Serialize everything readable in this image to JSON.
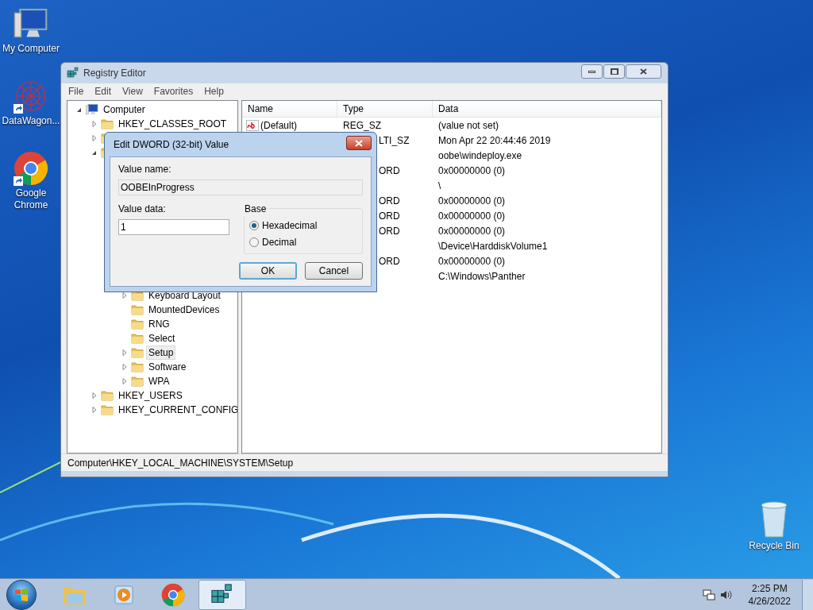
{
  "desktop_icons": [
    {
      "kind": "computer",
      "label": "My Computer",
      "shortcut": false
    },
    {
      "kind": "datawagon",
      "label": "DataWagon...",
      "shortcut": true
    },
    {
      "kind": "chrome",
      "label": "Google Chrome",
      "shortcut": true
    },
    {
      "kind": "recycle",
      "label": "Recycle Bin",
      "shortcut": false
    }
  ],
  "window": {
    "title": "Registry Editor",
    "menu": [
      "File",
      "Edit",
      "View",
      "Favorites",
      "Help"
    ],
    "tree": [
      {
        "kind": "computer",
        "label": "Computer",
        "expandable": true,
        "expanded": true,
        "selected": false,
        "children": [
          {
            "kind": "folder",
            "label": "HKEY_CLASSES_ROOT",
            "expandable": true,
            "expanded": false,
            "selected": false
          },
          {
            "kind": "folder",
            "expandable": true,
            "expanded": false
          },
          {
            "kind": "folder",
            "expandable": true,
            "expanded": true,
            "children": [
              {
                "expanded": true,
                "children": [
                  {
                    "kind": "folder",
                    "label": "Keyboard Layout",
                    "expandable": true,
                    "expanded": false,
                    "selected": false
                  },
                  {
                    "kind": "folder",
                    "label": "MountedDevices",
                    "expandable": false,
                    "selected": false
                  },
                  {
                    "kind": "folder",
                    "label": "RNG",
                    "expandable": false,
                    "selected": false
                  },
                  {
                    "kind": "folder",
                    "label": "Select",
                    "expandable": false,
                    "selected": false
                  },
                  {
                    "kind": "folder",
                    "label": "Setup",
                    "expandable": true,
                    "expanded": false,
                    "selected": true
                  },
                  {
                    "kind": "folder",
                    "label": "Software",
                    "expandable": true,
                    "expanded": false,
                    "selected": false
                  },
                  {
                    "kind": "folder",
                    "label": "WPA",
                    "expandable": true,
                    "expanded": false,
                    "selected": false
                  }
                ]
              }
            ]
          },
          {
            "kind": "folder",
            "label": "HKEY_USERS",
            "expandable": true,
            "expanded": false,
            "selected": false
          },
          {
            "kind": "folder",
            "label": "HKEY_CURRENT_CONFIG",
            "expandable": true,
            "expanded": false,
            "selected": false
          }
        ]
      }
    ],
    "columns": [
      "Name",
      "Type",
      "Data"
    ],
    "rows": [
      {
        "kind": "string",
        "name": "(Default)",
        "type": "REG_SZ",
        "data": "(value not set)",
        "clipped": false
      },
      {
        "kind": "hidden",
        "type": "LTI_SZ",
        "data": "Mon Apr 22 20:44:46 2019",
        "clipped": true
      },
      {
        "kind": "hidden",
        "data": "oobe\\windeploy.exe"
      },
      {
        "kind": "hidden",
        "type": "ORD",
        "data": "0x00000000 (0)",
        "clipped": true
      },
      {
        "kind": "hidden",
        "data": "\\"
      },
      {
        "kind": "hidden",
        "type": "ORD",
        "data": "0x00000000 (0)",
        "clipped": true
      },
      {
        "kind": "hidden",
        "type": "ORD",
        "data": "0x00000000 (0)",
        "clipped": true
      },
      {
        "kind": "hidden",
        "type": "ORD",
        "data": "0x00000000 (0)",
        "clipped": true
      },
      {
        "kind": "hidden",
        "data": "\\Device\\HarddiskVolume1"
      },
      {
        "kind": "hidden",
        "type": "ORD",
        "data": "0x00000000 (0)",
        "clipped": true
      },
      {
        "kind": "hidden",
        "data": "C:\\Windows\\Panther"
      }
    ],
    "status_bar": "Computer\\HKEY_LOCAL_MACHINE\\SYSTEM\\Setup"
  },
  "dialog": {
    "title": "Edit DWORD (32-bit) Value",
    "value_name_label": "Value name:",
    "value_name": "OOBEInProgress",
    "value_data_label": "Value data:",
    "value_data": "1",
    "base_label": "Base",
    "radios": [
      {
        "label": "Hexadecimal",
        "selected": true
      },
      {
        "label": "Decimal",
        "selected": false
      }
    ],
    "buttons": [
      {
        "label": "OK",
        "default": true
      },
      {
        "label": "Cancel",
        "default": false
      }
    ]
  },
  "taskbar": {
    "apps": [
      {
        "kind": "explorer",
        "active": false
      },
      {
        "kind": "media",
        "active": false
      },
      {
        "kind": "chrome",
        "active": false
      },
      {
        "kind": "regedit",
        "active": true
      }
    ],
    "time": "2:25 PM",
    "date": "4/26/2022"
  }
}
